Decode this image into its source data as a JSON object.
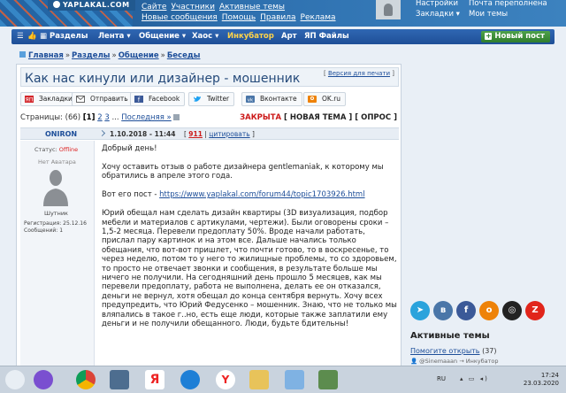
{
  "header": {
    "logo": "YAPLAKAL.COM",
    "nav": [
      "Сайте",
      "Участники",
      "Активные темы",
      "Новые сообщения",
      "Помощь",
      "Правила",
      "Реклама"
    ],
    "user_col1": [
      "Настройки",
      "Закладки"
    ],
    "user_col2": [
      "Почта переполнена",
      "Мои темы"
    ]
  },
  "navbar": {
    "items": [
      "Разделы",
      "Лента",
      "Общение",
      "Хаос",
      "Инкубатор",
      "Арт",
      "ЯП Файлы"
    ],
    "new_post": "Новый пост"
  },
  "breadcrumb": [
    "Главная",
    "Разделы",
    "Общение",
    "Беседы"
  ],
  "topic": {
    "title": "Как нас кинули или дизайнер - мошенник",
    "print_version": "Версия для печати"
  },
  "share": [
    "Закладки",
    "Отправить",
    "Facebook",
    "Twitter",
    "Вконтакте",
    "OK.ru"
  ],
  "pager": {
    "label": "Страницы:",
    "count": "(66)",
    "current": "[1]",
    "pages": [
      "2",
      "3"
    ],
    "ellipsis": "...",
    "last": "Последняя »"
  },
  "status": {
    "closed": "ЗАКРЫТА",
    "new_topic": "НОВАЯ ТЕМА",
    "poll": "ОПРОС"
  },
  "post": {
    "author": "ONIRON",
    "datetime": "1.10.2018 - 11:44",
    "number": "911",
    "quote": "цитировать",
    "status_label": "Статус:",
    "status_value": "Offline",
    "no_avatar": "Нет Аватара",
    "rank": "Шутник",
    "registered": "Регистрация: 25.12.16",
    "messages": "Сообщений: 1",
    "paragraphs": [
      "Добрый день!",
      "Хочу оставить отзыв о работе дизайнера gentlemaniak, к которому мы обратились в апреле этого года.",
      "Вот его пост - ",
      "Юрий обещал нам сделать дизайн квартиры (3D визуализация, подбор мебели и материалов с артикулами, чертежи). Были оговорены сроки – 1,5-2 месяца. Перевели предоплату 50%. Вроде начали работать, прислал пару картинок и на этом все. Дальше начались только обещания, что вот-вот пришлет, что почти готово, то в воскресенье, то через неделю, потом то у него то жилищные проблемы, то со здоровьем, то просто не отвечает звонки и сообщения, в результате больше мы ничего не получили. На сегодняшний день прошло 5 месяцев, как мы перевели предоплату, работа не выполнена, делать ее он отказался, деньги не вернул, хотя обещал до конца сентября вернуть. Хочу всех предупредить, что Юрий Федусенко – мошенник. Знаю, что не только мы вляпались в такое г..но, есть еще люди, которые также заплатили ему деньги и не получили обещанного. Люди, будьте бдительны!"
    ],
    "link": "https://www.yaplakal.com/forum44/topic1703926.html"
  },
  "sidebar": {
    "active_title": "Активные темы",
    "first_item": "Помогите открыть",
    "first_count": "(37)",
    "first_author": "@Sinemaaan",
    "first_section": "Инкубатор"
  },
  "taskbar": {
    "lang": "RU",
    "time": "17:24",
    "date": "23.03.2020"
  },
  "colors": {
    "accent": "#1f4f97",
    "closed": "#cc1a1a",
    "incubator": "#ffd34a",
    "new_post": "#2f7d2c"
  }
}
